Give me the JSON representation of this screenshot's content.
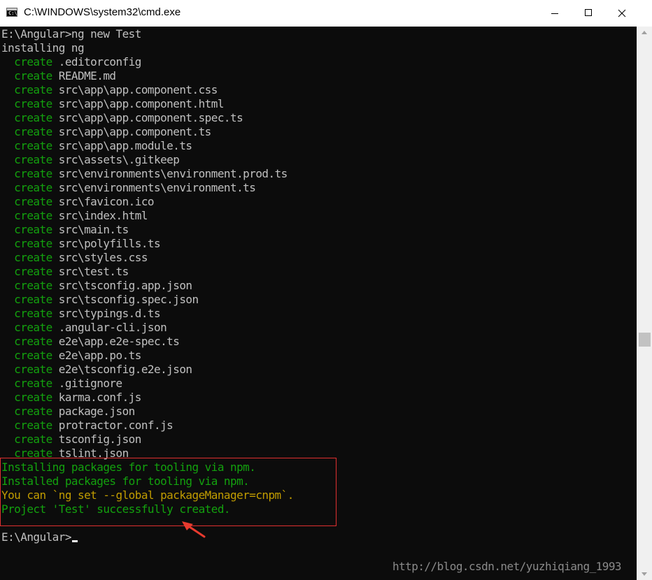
{
  "window": {
    "title": "C:\\WINDOWS\\system32\\cmd.exe",
    "icon_text": "C:\\"
  },
  "console": {
    "lines": [
      {
        "style": "plain",
        "text": "E:\\Angular>ng new Test"
      },
      {
        "style": "plain",
        "text": "installing ng"
      },
      {
        "style": "create",
        "prefix": "  create",
        "text": " .editorconfig"
      },
      {
        "style": "create",
        "prefix": "  create",
        "text": " README.md"
      },
      {
        "style": "create",
        "prefix": "  create",
        "text": " src\\app\\app.component.css"
      },
      {
        "style": "create",
        "prefix": "  create",
        "text": " src\\app\\app.component.html"
      },
      {
        "style": "create",
        "prefix": "  create",
        "text": " src\\app\\app.component.spec.ts"
      },
      {
        "style": "create",
        "prefix": "  create",
        "text": " src\\app\\app.component.ts"
      },
      {
        "style": "create",
        "prefix": "  create",
        "text": " src\\app\\app.module.ts"
      },
      {
        "style": "create",
        "prefix": "  create",
        "text": " src\\assets\\.gitkeep"
      },
      {
        "style": "create",
        "prefix": "  create",
        "text": " src\\environments\\environment.prod.ts"
      },
      {
        "style": "create",
        "prefix": "  create",
        "text": " src\\environments\\environment.ts"
      },
      {
        "style": "create",
        "prefix": "  create",
        "text": " src\\favicon.ico"
      },
      {
        "style": "create",
        "prefix": "  create",
        "text": " src\\index.html"
      },
      {
        "style": "create",
        "prefix": "  create",
        "text": " src\\main.ts"
      },
      {
        "style": "create",
        "prefix": "  create",
        "text": " src\\polyfills.ts"
      },
      {
        "style": "create",
        "prefix": "  create",
        "text": " src\\styles.css"
      },
      {
        "style": "create",
        "prefix": "  create",
        "text": " src\\test.ts"
      },
      {
        "style": "create",
        "prefix": "  create",
        "text": " src\\tsconfig.app.json"
      },
      {
        "style": "create",
        "prefix": "  create",
        "text": " src\\tsconfig.spec.json"
      },
      {
        "style": "create",
        "prefix": "  create",
        "text": " src\\typings.d.ts"
      },
      {
        "style": "create",
        "prefix": "  create",
        "text": " .angular-cli.json"
      },
      {
        "style": "create",
        "prefix": "  create",
        "text": " e2e\\app.e2e-spec.ts"
      },
      {
        "style": "create",
        "prefix": "  create",
        "text": " e2e\\app.po.ts"
      },
      {
        "style": "create",
        "prefix": "  create",
        "text": " e2e\\tsconfig.e2e.json"
      },
      {
        "style": "create",
        "prefix": "  create",
        "text": " .gitignore"
      },
      {
        "style": "create",
        "prefix": "  create",
        "text": " karma.conf.js"
      },
      {
        "style": "create",
        "prefix": "  create",
        "text": " package.json"
      },
      {
        "style": "create",
        "prefix": "  create",
        "text": " protractor.conf.js"
      },
      {
        "style": "create",
        "prefix": "  create",
        "text": " tsconfig.json"
      },
      {
        "style": "create",
        "prefix": "  create",
        "text": " tslint.json"
      },
      {
        "style": "green",
        "text": "Installing packages for tooling via npm."
      },
      {
        "style": "green",
        "text": "Installed packages for tooling via npm."
      },
      {
        "style": "yellow",
        "text": "You can `ng set --global packageManager=cnpm`."
      },
      {
        "style": "green",
        "text": "Project 'Test' successfully created."
      },
      {
        "style": "plain",
        "text": ""
      },
      {
        "style": "prompt",
        "text": "E:\\Angular>"
      }
    ]
  },
  "watermark": "http://blog.csdn.net/yuzhiqiang_1993",
  "colors": {
    "console_bg": "#0c0c0c",
    "default_text": "#c0c0c0",
    "green": "#13a10e",
    "yellow": "#c19c00",
    "highlight_border": "#e03030"
  }
}
